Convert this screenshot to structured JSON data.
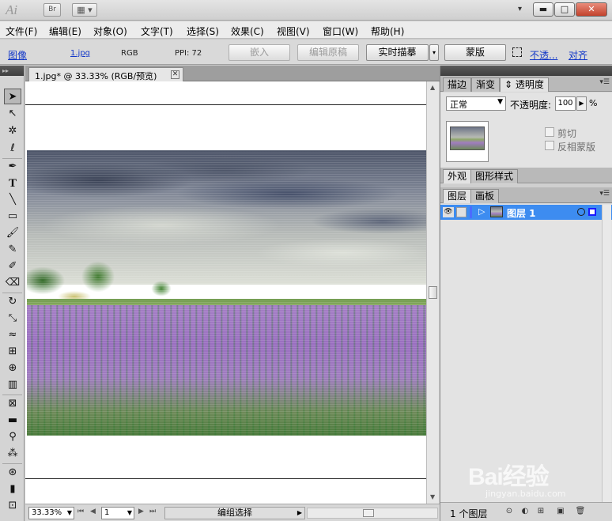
{
  "app": {
    "logo": "Ai",
    "bridge": "Br",
    "workspace_icon": "▦ ▾"
  },
  "window": {
    "workspace_caret": "▾",
    "minimize": "▬",
    "maximize": "□",
    "close": "✕"
  },
  "menu": [
    "文件(F)",
    "编辑(E)",
    "对象(O)",
    "文字(T)",
    "选择(S)",
    "效果(C)",
    "视图(V)",
    "窗口(W)",
    "帮助(H)"
  ],
  "control": {
    "object_type": "图像",
    "file_link": "1.jpg",
    "color_mode": "RGB",
    "ppi": "PPI: 72",
    "embed": "嵌入",
    "edit_original": "编辑原稿",
    "live_trace": "实时描摹",
    "mask": "蒙版",
    "opacity_link": "不透...",
    "align_link": "对齐"
  },
  "document": {
    "tab_title": "1.jpg* @ 33.33% (RGB/预览)",
    "tab_close": "✕"
  },
  "status": {
    "zoom": "33.33%",
    "artboard": "1",
    "label": "编组选择"
  },
  "panels": {
    "top_tabs": [
      "描边",
      "渐变",
      "透明度"
    ],
    "blend_mode": "正常",
    "opacity_label": "不透明度:",
    "opacity_value": "100",
    "opacity_unit": "%",
    "clip": "剪切",
    "invert_mask": "反相蒙版",
    "mid_tabs": [
      "外观",
      "图形样式"
    ],
    "layer_tabs": [
      "图层",
      "画板"
    ],
    "layer_name": "图层 1",
    "layer_count": "1 个图层"
  },
  "watermark": {
    "logo": "Bai经验",
    "url": "jingyan.baidu.com"
  },
  "colors": {
    "accent": "#3d8cf0",
    "link": "#1237c8",
    "panel": "#d6d6d6"
  }
}
